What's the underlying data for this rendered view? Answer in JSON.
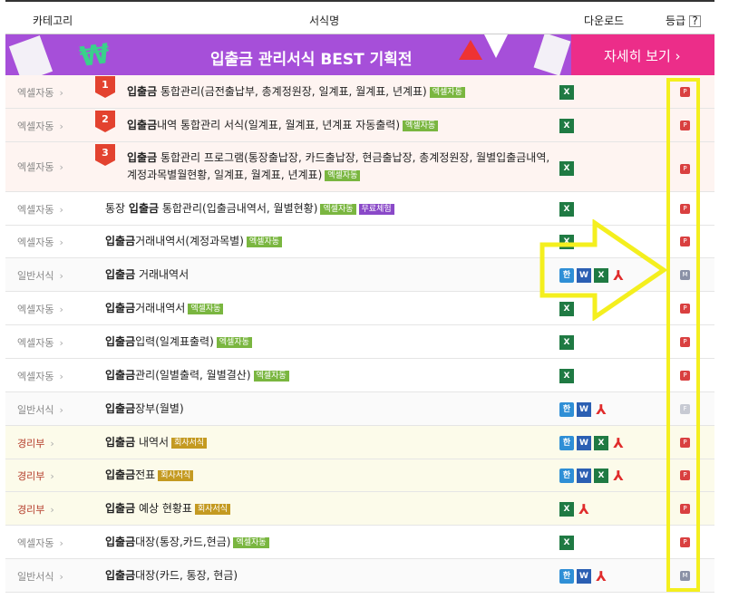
{
  "header": {
    "category": "카테고리",
    "name": "서식명",
    "download": "다운로드",
    "grade": "등급",
    "help": "?"
  },
  "banner": {
    "title": "입출금 관리서식 BEST 기획전",
    "detail": "자세히 보기  ›",
    "deco": "₩"
  },
  "rows": [
    {
      "category": "엑셀자동",
      "rank": "1",
      "title_bold": "입출금",
      "title_rest": " 통합관리(금전출납부, 총계정원장, 일계표, 월계표, 년계표)",
      "tag": "엑셀자동",
      "grade": "P"
    },
    {
      "category": "엑셀자동",
      "rank": "2",
      "title_bold": "입출금",
      "title_rest": "내역 통합관리 서식(일계표, 월계표, 년계표 자동출력)",
      "tag": "엑셀자동",
      "grade": "P"
    },
    {
      "category": "엑셀자동",
      "rank": "3",
      "title_bold": "입출금",
      "title_rest": " 통합관리 프로그램(통장출납장, 카드출납장, 현금출납장, 총계정원장, 월별입출금내역, 계정과목별월현황, 일계표, 월계표, 년계표)",
      "tag": "엑셀자동",
      "grade": "P"
    },
    {
      "category": "엑셀자동",
      "title_pre": "통장 ",
      "title_bold": "입출금",
      "title_rest": " 통합관리(입출금내역서, 월별현황)",
      "tag": "엑셀자동",
      "tag2": "무료체험",
      "grade": "P"
    },
    {
      "category": "엑셀자동",
      "title_bold": "입출금",
      "title_rest": "거래내역서(계정과목별)",
      "tag": "엑셀자동",
      "grade": "P"
    },
    {
      "category": "일반서식",
      "title_bold": "입출금",
      "title_rest": " 거래내역서",
      "grade": "M"
    },
    {
      "category": "엑셀자동",
      "title_bold": "입출금",
      "title_rest": "거래내역서",
      "tag": "엑셀자동",
      "grade": "P"
    },
    {
      "category": "엑셀자동",
      "title_bold": "입출금",
      "title_rest": "입력(일계표출력)",
      "tag": "엑셀자동",
      "grade": "P"
    },
    {
      "category": "엑셀자동",
      "title_bold": "입출금",
      "title_rest": "관리(일별출력, 월별결산)",
      "tag": "엑셀자동",
      "grade": "P"
    },
    {
      "category": "일반서식",
      "title_bold": "입출금",
      "title_rest": "장부(월별)",
      "grade": "F"
    },
    {
      "category": "경리부",
      "title_bold": "입출금",
      "title_rest": " 내역서",
      "tag": "회사서식",
      "grade": "P"
    },
    {
      "category": "경리부",
      "title_bold": "입출금",
      "title_rest": "전표",
      "tag": "회사서식",
      "grade": "P"
    },
    {
      "category": "경리부",
      "title_bold": "입출금",
      "title_rest": " 예상 현황표",
      "tag": "회사서식",
      "grade": "P"
    },
    {
      "category": "엑셀자동",
      "title_bold": "입출금",
      "title_rest": "대장(통장,카드,현금)",
      "tag": "엑셀자동",
      "grade": "P"
    },
    {
      "category": "일반서식",
      "title_bold": "입출금",
      "title_rest": "대장(카드, 통장, 현금)",
      "grade": "M"
    }
  ],
  "icons": {
    "excel": "X",
    "hwp": "한",
    "word": "W",
    "pdf": "⅄"
  },
  "colors": {
    "banner_purple": "#a64fd9",
    "banner_pink": "#ec2d89",
    "highlight": "#f4ef1e",
    "premium": "#d94040"
  }
}
